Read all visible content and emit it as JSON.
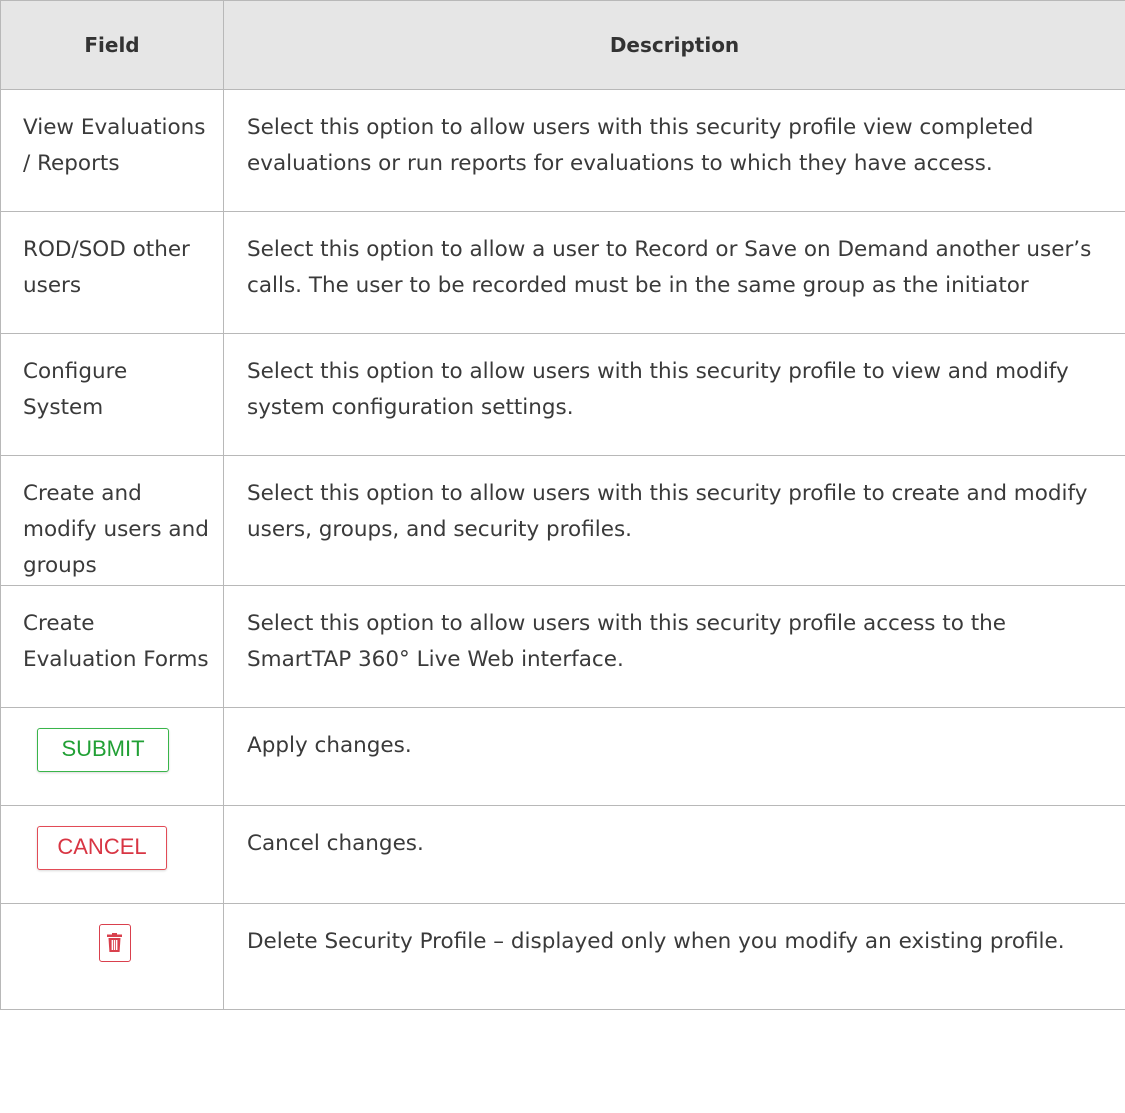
{
  "table": {
    "headers": {
      "field": "Field",
      "description": "Description"
    },
    "rows": [
      {
        "field": "View Evaluations / Reports",
        "description": "Select this option to allow users with this security profile view completed evaluations or run reports for evaluations to which they have access."
      },
      {
        "field": "ROD/SOD other users",
        "description": "Select this option to allow a user to Record or Save on Demand another user’s calls. The user to be recorded must be in the same group as the initiator"
      },
      {
        "field": "Configure System",
        "description": "Select this option to allow users with this security profile to view and modify system configuration settings."
      },
      {
        "field": "Create and modify users and groups",
        "description": "Select this option to allow users with this security profile to create and modify users, groups, and security profiles."
      },
      {
        "field": "Create Evaluation Forms",
        "description": "Select this option to allow users with this security profile access to the SmartTAP 360° Live Web interface."
      }
    ],
    "button_rows": {
      "submit": {
        "label": "SUBMIT",
        "description": "Apply changes."
      },
      "cancel": {
        "label": "CANCEL",
        "description": "Cancel changes."
      },
      "delete": {
        "icon": "trash-icon",
        "description": "Delete Security Profile – displayed only when you modify an existing profile."
      }
    }
  },
  "colors": {
    "header_bg": "#e6e6e6",
    "border": "#b8b8b8",
    "submit_green": "#21a035",
    "cancel_red": "#d83543",
    "delete_red": "#d9404d"
  }
}
